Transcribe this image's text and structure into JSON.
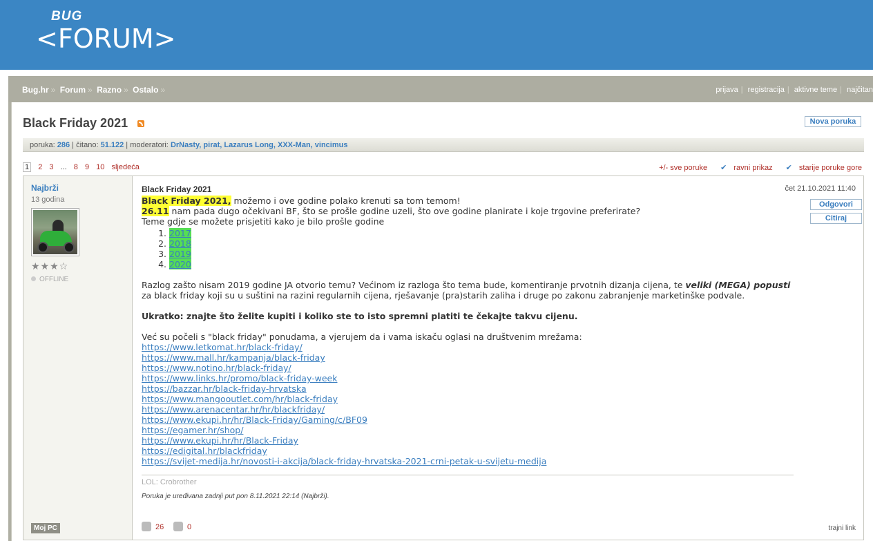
{
  "header": {
    "logo_top": "BUG",
    "logo_bottom": "<FORUM>"
  },
  "breadcrumb": [
    "Bug.hr",
    "Forum",
    "Razno",
    "Ostalo"
  ],
  "breadcrumb_sep": "»",
  "top_links": [
    "prijava",
    "registracija",
    "aktivne teme",
    "najčitan"
  ],
  "thread": {
    "title": "Black Friday 2021",
    "new_post_label": "Nova poruka",
    "stats": {
      "posts_label": "poruka:",
      "posts": "286",
      "read_label": "čitano:",
      "read": "51.122",
      "moderators_label": "moderatori:",
      "moderators": "DrNasty, pirat, Lazarus Long, XXX-Man, vincimus"
    }
  },
  "pager": {
    "current": "1",
    "pages": [
      "2",
      "3",
      "...",
      "8",
      "9",
      "10"
    ],
    "next": "sljedeća"
  },
  "view_options": {
    "all_posts": "+/- sve poruke",
    "flat": "ravni prikaz",
    "older_top": "starije poruke gore"
  },
  "post": {
    "author": "Najbrži",
    "age": "13 godina",
    "stars": "★★★☆",
    "status": "OFFLINE",
    "moj_pc": "Moj PC",
    "title": "Black Friday 2021",
    "date": "čet 21.10.2021 11:40",
    "reply_label": "Odgovori",
    "quote_label": "Citiraj",
    "line1_hl": "Black Friday 2021,",
    "line1_rest": " možemo i ove godine polako krenuti sa tom temom!",
    "line2_hl": "26.11",
    "line2_rest": " nam pada dugo očekivani BF, što se prošle godine uzeli, što ove godine planirate i koje trgovine preferirate?",
    "line3": "Teme gdje se možete prisjetiti kako je bilo prošle godine",
    "years": [
      "2017",
      "2018",
      "2019",
      "2020"
    ],
    "para1_a": "Razlog zašto nisam 2019 godine JA otvorio temu? Većinom iz razloga što tema bude, komentiranje prvotnih dizanja cijena, te ",
    "para1_em": "veliki (MEGA) popusti",
    "para1_b": "za black friday koji su u suštini na razini regularnih cijena, rješavanje (pra)starih zaliha i druge po zakonu zabranjenje marketinške podvale.",
    "summary": "Ukratko: znajte što želite kupiti i koliko ste to isto spremni platiti te čekajte takvu cijenu.",
    "links_intro": "Već su počeli s \"black friday\" ponudama, a vjerujem da i vama iskaču oglasi na društvenim mrežama:",
    "links": [
      "https://www.letkomat.hr/black-friday/",
      "https://www.mall.hr/kampanja/black-friday",
      "https://www.notino.hr/black-friday/",
      "https://www.links.hr/promo/black-friday-week",
      "https://bazzar.hr/black-friday-hrvatska",
      "https://www.mangooutlet.com/hr/black-friday",
      "https://www.arenacentar.hr/hr/blackfriday/",
      "https://www.ekupi.hr/hr/Black-Friday/Gaming/c/BF09",
      "https://egamer.hr/shop/",
      "https://www.ekupi.hr/hr/Black-Friday",
      "https://edigital.hr/blackfriday",
      "https://svijet-medija.hr/novosti-i-akcija/black-friday-hrvatska-2021-crni-petak-u-svijetu-medija"
    ],
    "signature": "LOL: Crobrother",
    "edited": "Poruka je uređivana zadnji put pon 8.11.2021 22:14 (Najbrži).",
    "likes": "26",
    "dislikes": "0",
    "permalink": "trajni link"
  }
}
